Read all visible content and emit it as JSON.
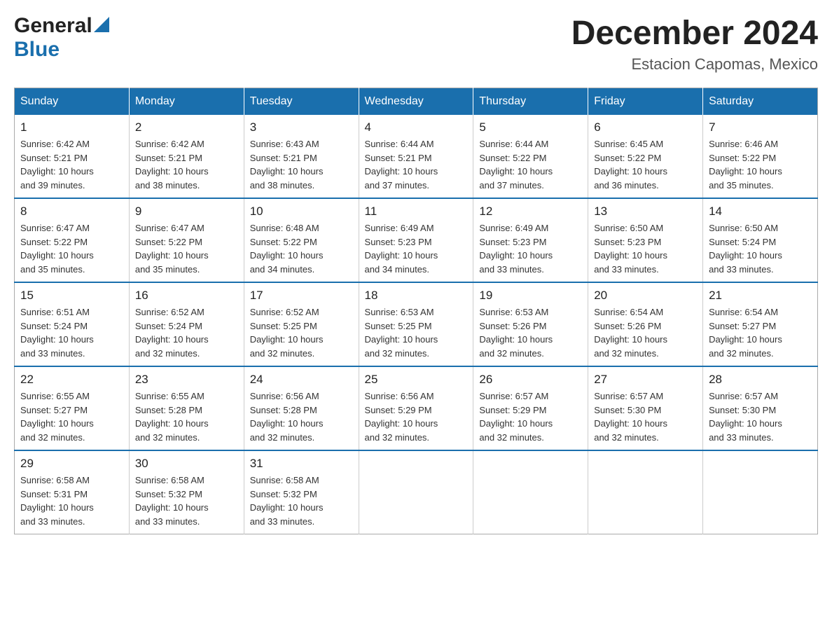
{
  "header": {
    "logo_general": "General",
    "logo_blue": "Blue",
    "month_title": "December 2024",
    "location": "Estacion Capomas, Mexico"
  },
  "days_of_week": [
    "Sunday",
    "Monday",
    "Tuesday",
    "Wednesday",
    "Thursday",
    "Friday",
    "Saturday"
  ],
  "weeks": [
    [
      {
        "day": "1",
        "sunrise": "6:42 AM",
        "sunset": "5:21 PM",
        "daylight": "10 hours and 39 minutes."
      },
      {
        "day": "2",
        "sunrise": "6:42 AM",
        "sunset": "5:21 PM",
        "daylight": "10 hours and 38 minutes."
      },
      {
        "day": "3",
        "sunrise": "6:43 AM",
        "sunset": "5:21 PM",
        "daylight": "10 hours and 38 minutes."
      },
      {
        "day": "4",
        "sunrise": "6:44 AM",
        "sunset": "5:21 PM",
        "daylight": "10 hours and 37 minutes."
      },
      {
        "day": "5",
        "sunrise": "6:44 AM",
        "sunset": "5:22 PM",
        "daylight": "10 hours and 37 minutes."
      },
      {
        "day": "6",
        "sunrise": "6:45 AM",
        "sunset": "5:22 PM",
        "daylight": "10 hours and 36 minutes."
      },
      {
        "day": "7",
        "sunrise": "6:46 AM",
        "sunset": "5:22 PM",
        "daylight": "10 hours and 35 minutes."
      }
    ],
    [
      {
        "day": "8",
        "sunrise": "6:47 AM",
        "sunset": "5:22 PM",
        "daylight": "10 hours and 35 minutes."
      },
      {
        "day": "9",
        "sunrise": "6:47 AM",
        "sunset": "5:22 PM",
        "daylight": "10 hours and 35 minutes."
      },
      {
        "day": "10",
        "sunrise": "6:48 AM",
        "sunset": "5:22 PM",
        "daylight": "10 hours and 34 minutes."
      },
      {
        "day": "11",
        "sunrise": "6:49 AM",
        "sunset": "5:23 PM",
        "daylight": "10 hours and 34 minutes."
      },
      {
        "day": "12",
        "sunrise": "6:49 AM",
        "sunset": "5:23 PM",
        "daylight": "10 hours and 33 minutes."
      },
      {
        "day": "13",
        "sunrise": "6:50 AM",
        "sunset": "5:23 PM",
        "daylight": "10 hours and 33 minutes."
      },
      {
        "day": "14",
        "sunrise": "6:50 AM",
        "sunset": "5:24 PM",
        "daylight": "10 hours and 33 minutes."
      }
    ],
    [
      {
        "day": "15",
        "sunrise": "6:51 AM",
        "sunset": "5:24 PM",
        "daylight": "10 hours and 33 minutes."
      },
      {
        "day": "16",
        "sunrise": "6:52 AM",
        "sunset": "5:24 PM",
        "daylight": "10 hours and 32 minutes."
      },
      {
        "day": "17",
        "sunrise": "6:52 AM",
        "sunset": "5:25 PM",
        "daylight": "10 hours and 32 minutes."
      },
      {
        "day": "18",
        "sunrise": "6:53 AM",
        "sunset": "5:25 PM",
        "daylight": "10 hours and 32 minutes."
      },
      {
        "day": "19",
        "sunrise": "6:53 AM",
        "sunset": "5:26 PM",
        "daylight": "10 hours and 32 minutes."
      },
      {
        "day": "20",
        "sunrise": "6:54 AM",
        "sunset": "5:26 PM",
        "daylight": "10 hours and 32 minutes."
      },
      {
        "day": "21",
        "sunrise": "6:54 AM",
        "sunset": "5:27 PM",
        "daylight": "10 hours and 32 minutes."
      }
    ],
    [
      {
        "day": "22",
        "sunrise": "6:55 AM",
        "sunset": "5:27 PM",
        "daylight": "10 hours and 32 minutes."
      },
      {
        "day": "23",
        "sunrise": "6:55 AM",
        "sunset": "5:28 PM",
        "daylight": "10 hours and 32 minutes."
      },
      {
        "day": "24",
        "sunrise": "6:56 AM",
        "sunset": "5:28 PM",
        "daylight": "10 hours and 32 minutes."
      },
      {
        "day": "25",
        "sunrise": "6:56 AM",
        "sunset": "5:29 PM",
        "daylight": "10 hours and 32 minutes."
      },
      {
        "day": "26",
        "sunrise": "6:57 AM",
        "sunset": "5:29 PM",
        "daylight": "10 hours and 32 minutes."
      },
      {
        "day": "27",
        "sunrise": "6:57 AM",
        "sunset": "5:30 PM",
        "daylight": "10 hours and 32 minutes."
      },
      {
        "day": "28",
        "sunrise": "6:57 AM",
        "sunset": "5:30 PM",
        "daylight": "10 hours and 33 minutes."
      }
    ],
    [
      {
        "day": "29",
        "sunrise": "6:58 AM",
        "sunset": "5:31 PM",
        "daylight": "10 hours and 33 minutes."
      },
      {
        "day": "30",
        "sunrise": "6:58 AM",
        "sunset": "5:32 PM",
        "daylight": "10 hours and 33 minutes."
      },
      {
        "day": "31",
        "sunrise": "6:58 AM",
        "sunset": "5:32 PM",
        "daylight": "10 hours and 33 minutes."
      },
      null,
      null,
      null,
      null
    ]
  ],
  "labels": {
    "sunrise": "Sunrise:",
    "sunset": "Sunset:",
    "daylight": "Daylight:"
  }
}
